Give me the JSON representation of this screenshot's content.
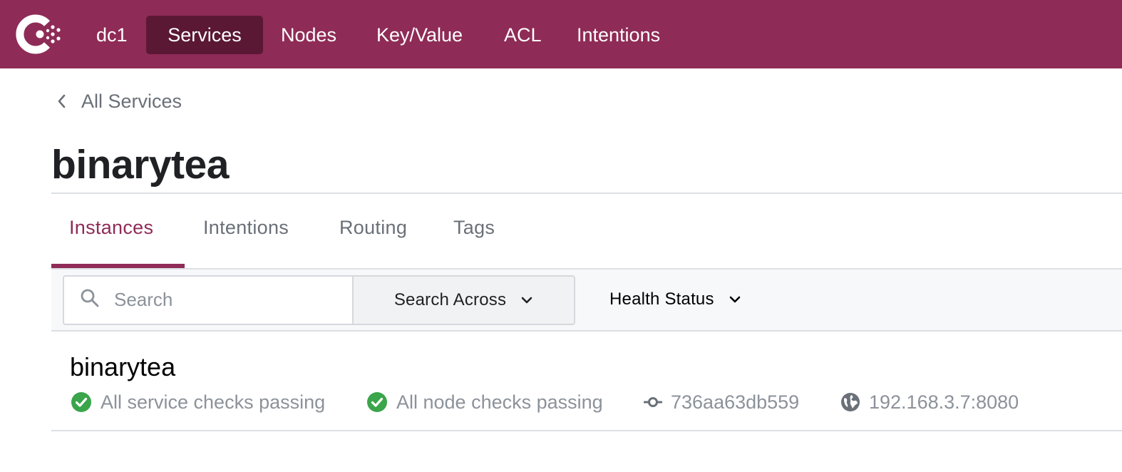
{
  "nav": {
    "logo_icon": "consul-logo-icon",
    "datacenter": "dc1",
    "items": [
      {
        "label": "Services",
        "active": true
      },
      {
        "label": "Nodes"
      },
      {
        "label": "Key/Value"
      },
      {
        "label": "ACL"
      },
      {
        "label": "Intentions"
      }
    ]
  },
  "breadcrumb": {
    "label": "All Services",
    "icon": "chevron-left-icon"
  },
  "page": {
    "title": "binarytea"
  },
  "tabs": [
    {
      "label": "Instances",
      "active": true
    },
    {
      "label": "Intentions"
    },
    {
      "label": "Routing"
    },
    {
      "label": "Tags"
    }
  ],
  "filters": {
    "search_placeholder": "Search",
    "search_across_label": "Search Across",
    "health_status_label": "Health Status"
  },
  "instance": {
    "name": "binarytea",
    "service_checks": "All service checks passing",
    "node_checks": "All node checks passing",
    "id": "736aa63db559",
    "address": "192.168.3.7:8080"
  },
  "colors": {
    "brand": "#8f2b57",
    "brand_dark": "#5a1834",
    "passing": "#3aa54a",
    "muted": "#8c929a"
  }
}
